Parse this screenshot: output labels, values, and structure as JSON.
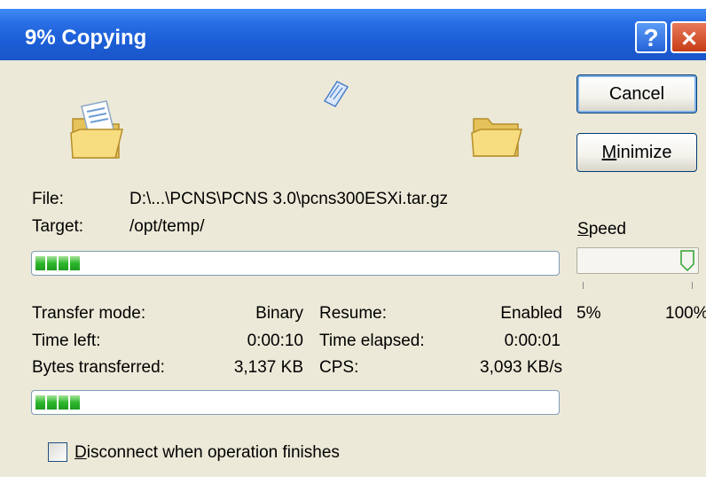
{
  "window": {
    "title": "9% Copying",
    "help_glyph": "?",
    "close_glyph": "✕"
  },
  "buttons": {
    "cancel": "Cancel",
    "minimize_prefix": "M",
    "minimize_rest": "inimize"
  },
  "file": {
    "label": "File:",
    "value": "D:\\...\\PCNS\\PCNS 3.0\\pcns300ESXi.tar.gz"
  },
  "target": {
    "label": "Target:",
    "value": "/opt/temp/"
  },
  "speed": {
    "label_prefix": "S",
    "label_rest": "peed",
    "min_label": "5%",
    "max_label": "100%",
    "level": 1.0
  },
  "stats": {
    "transfer_mode_label": "Transfer mode:",
    "transfer_mode_value": "Binary",
    "resume_label": "Resume:",
    "resume_value": "Enabled",
    "time_left_label": "Time left:",
    "time_left_value": "0:00:10",
    "time_elapsed_label": "Time elapsed:",
    "time_elapsed_value": "0:00:01",
    "bytes_label": "Bytes transferred:",
    "bytes_value": "3,137 KB",
    "cps_label": "CPS:",
    "cps_value": "3,093 KB/s"
  },
  "progress": {
    "file_percent": 9,
    "total_percent": 9
  },
  "disconnect": {
    "label_prefix": "D",
    "label_rest": "isconnect when operation finishes",
    "checked": false
  },
  "colors": {
    "titlebar": "#1c5fd8",
    "dialog_bg": "#ece9d8",
    "progress_green": "#2db82d"
  },
  "icons": {
    "source": "folder-with-document-icon",
    "transfer": "flying-document-icon",
    "destination": "folder-icon"
  }
}
